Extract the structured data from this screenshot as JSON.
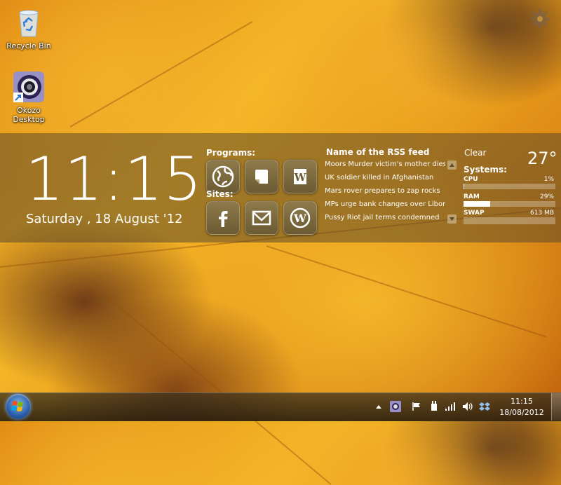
{
  "desktop": {
    "icons": [
      {
        "label": "Recycle Bin"
      },
      {
        "label": "Okozo Desktop"
      }
    ]
  },
  "clock": {
    "time": "11:15",
    "date": "Saturday , 18 August '12"
  },
  "launcher": {
    "programs_label": "Programs:",
    "sites_label": "Sites:",
    "programs": [
      "globe-icon",
      "notes-icon",
      "word-icon"
    ],
    "sites": [
      "facebook-icon",
      "gmail-icon",
      "wordpress-icon"
    ]
  },
  "rss": {
    "title": "Name of the RSS feed",
    "items": [
      "Moors Murder victim's mother dies",
      "UK soldier killed in Afghanistan",
      "Mars rover prepares to zap rocks",
      "MPs urge bank changes over Libor",
      "Pussy Riot jail terms condemned"
    ]
  },
  "weather": {
    "condition": "Clear",
    "temperature": "27°"
  },
  "systems": {
    "title": "Systems:",
    "cpu": {
      "label": "CPU",
      "value": "1%",
      "fraction": 0.01
    },
    "ram": {
      "label": "RAM",
      "value": "29%",
      "fraction": 0.29
    },
    "swap": {
      "label": "SWAP",
      "value": "613 MB"
    }
  },
  "taskbar": {
    "time": "11:15",
    "date": "18/08/2012",
    "tray_icons": [
      "show-hidden-icon",
      "okozo-tray-icon",
      "action-center-flag-icon",
      "power-icon",
      "network-signal-icon",
      "volume-icon",
      "dropbox-icon"
    ]
  },
  "colors": {
    "band": "#5f4b28",
    "accent_white": "#ffffff"
  }
}
